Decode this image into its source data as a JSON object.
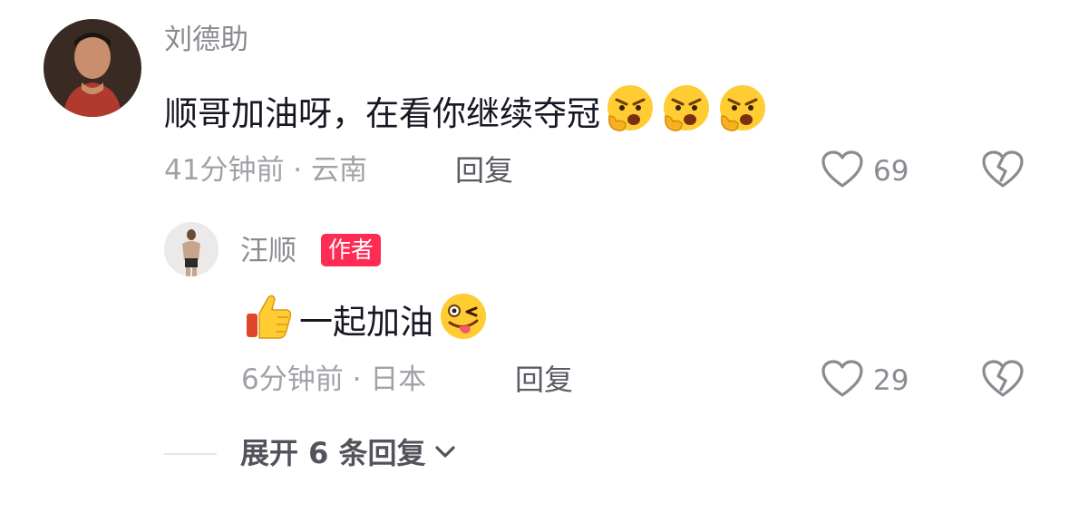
{
  "comment": {
    "username": "刘德助",
    "text": "顺哥加油呀，在看你继续夺冠",
    "emojis": [
      "angry-emoji",
      "angry-emoji",
      "angry-emoji"
    ],
    "time_location": "41分钟前 · 云南",
    "reply_label": "回复",
    "like_count": "69"
  },
  "reply": {
    "username": "汪顺",
    "badge": "作者",
    "text": "一起加油",
    "emojis": [
      "thumbs-up-emoji",
      "winking-tongue-emoji"
    ],
    "time_location": "6分钟前 · 日本",
    "reply_label": "回复",
    "like_count": "29"
  },
  "expand": {
    "label": "展开 6 条回复"
  },
  "colors": {
    "accent_badge": "#fe2c55",
    "muted_text": "#8a8b91",
    "emoji_yellow": "#ffcc33"
  }
}
